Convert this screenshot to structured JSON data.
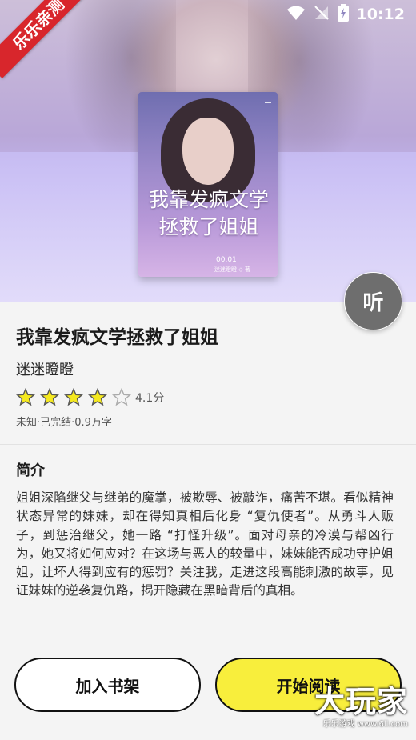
{
  "status_bar": {
    "time": "10:12"
  },
  "ribbon": {
    "label": "乐乐亲测"
  },
  "hero": {
    "bg_script": "我靠发疯文学\n拯救了姐姐"
  },
  "cover": {
    "title": "我靠发疯文学拯救了姐姐",
    "episode": "00.01",
    "sub": "迷迷瞪瞪 ◇ 著"
  },
  "listen_button": {
    "label": "听"
  },
  "book": {
    "title": "我靠发疯文学拯救了姐姐",
    "author": "迷迷瞪瞪",
    "rating": 4.1,
    "rating_label": "4.1分",
    "stars_filled": 4,
    "stars_total": 5,
    "meta": "未知·已完结·0.9万字"
  },
  "intro": {
    "heading": "简介",
    "text": "姐姐深陷继父与继弟的魔掌，被欺辱、被敲诈，痛苦不堪。看似精神状态异常的妹妹，却在得知真相后化身 “复仇使者”。从勇斗人贩子，到惩治继父，她一路 “打怪升级”。面对母亲的冷漠与帮凶行为，她又将如何应对？在这场与恶人的较量中，妹妹能否成功守护姐姐，让坏人得到应有的惩罚？关注我，走进这段高能刺激的故事，见证妹妹的逆袭复仇路，揭开隐藏在黑暗背后的真相。"
  },
  "buttons": {
    "add_shelf": "加入书架",
    "start_read": "开始阅读"
  },
  "watermark": {
    "main": "大玩家",
    "sub": "乐乐游戏 www.6ll.com"
  },
  "colors": {
    "star": "#f5e91f",
    "read_button": "#f8ee3c",
    "ribbon": "#d8262c"
  }
}
